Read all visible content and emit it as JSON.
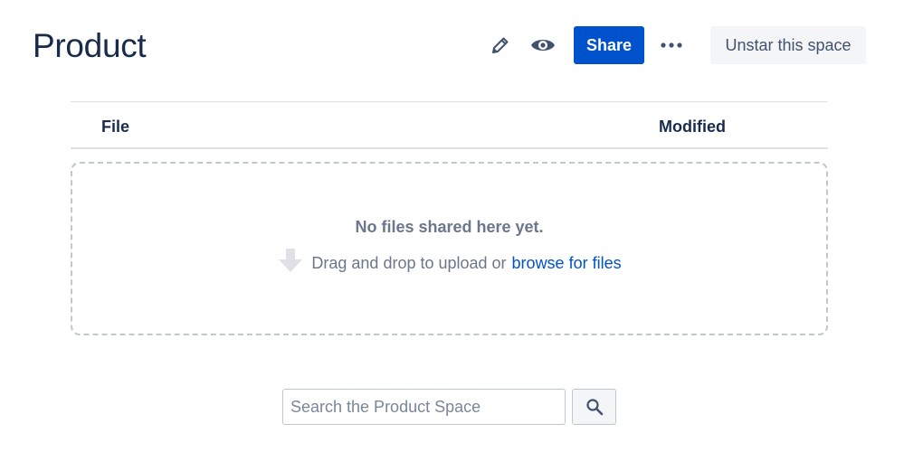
{
  "page": {
    "title": "Product"
  },
  "toolbar": {
    "edit_icon": "pencil-icon",
    "watch_icon": "eye-icon",
    "share_label": "Share",
    "more_icon": "more-dots-icon",
    "star_label": "Unstar this space",
    "colors": {
      "primary": "#0052cc",
      "neutral_bg": "#f4f5f7",
      "icon": "#42526e"
    }
  },
  "files_table": {
    "columns": [
      "File",
      "Modified"
    ]
  },
  "dropzone": {
    "empty_message": "No files shared here yet.",
    "drag_text": "Drag and drop to upload or",
    "browse_link": "browse for files",
    "arrow_icon": "down-arrow-icon"
  },
  "search": {
    "placeholder": "Search the Product Space",
    "value": "",
    "button_icon": "search-icon"
  }
}
